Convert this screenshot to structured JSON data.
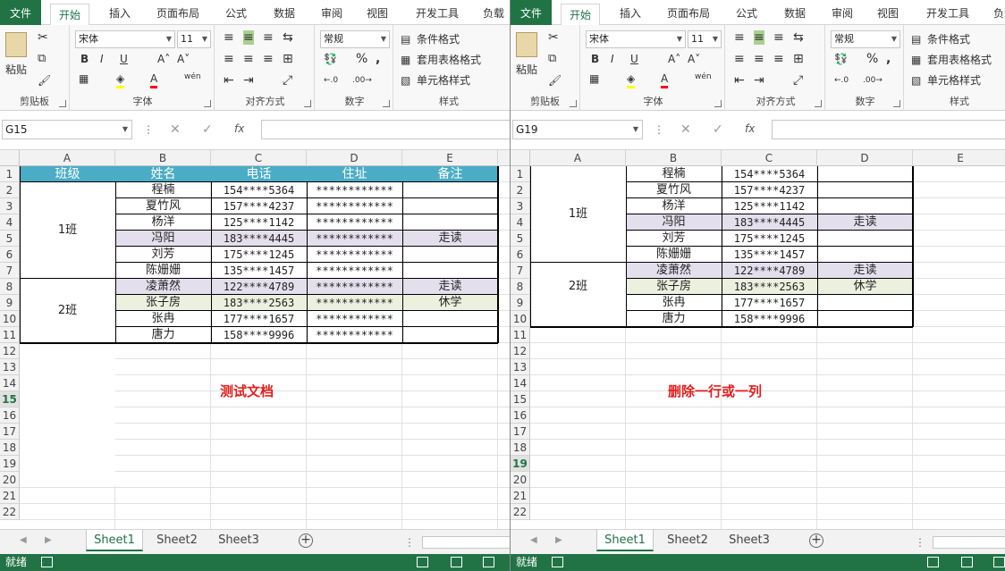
{
  "ribbon_tabs": [
    "文件",
    "开始",
    "插入",
    "页面布局",
    "公式",
    "数据",
    "审阅",
    "视图",
    "开发工具",
    "负载"
  ],
  "ribbon": {
    "clipboard": {
      "paste": "粘贴",
      "label": "剪贴板"
    },
    "font": {
      "name": "宋体",
      "size": "11",
      "label": "字体",
      "bold": "B",
      "italic": "I",
      "underline": "U",
      "wen": "wén"
    },
    "alignment": {
      "label": "对齐方式"
    },
    "number": {
      "format": "常规",
      "percent": "%",
      "comma": ",",
      "label": "数字"
    },
    "styles": {
      "conditional": "条件格式",
      "table": "套用表格格式",
      "cell": "单元格样式",
      "label": "样式"
    }
  },
  "colors": {
    "excel_green": "#217346",
    "header_fill": "#4bacc6",
    "lavender": "#e4dfec",
    "light_green": "#ebf1de",
    "red": "#e02020"
  },
  "columns": [
    "A",
    "B",
    "C",
    "D",
    "E"
  ],
  "left": {
    "namebox": "G15",
    "header_row": [
      "班级",
      "姓名",
      "电话",
      "住址",
      "备注"
    ],
    "class1": "1班",
    "class2": "2班",
    "rows": [
      {
        "name": "程楠",
        "phone": "154****5364",
        "addr": "************",
        "note": ""
      },
      {
        "name": "夏竹风",
        "phone": "157****4237",
        "addr": "************",
        "note": ""
      },
      {
        "name": "杨洋",
        "phone": "125****1142",
        "addr": "************",
        "note": ""
      },
      {
        "name": "冯阳",
        "phone": "183****4445",
        "addr": "************",
        "note": "走读"
      },
      {
        "name": "刘芳",
        "phone": "175****1245",
        "addr": "************",
        "note": ""
      },
      {
        "name": "陈姗姗",
        "phone": "135****1457",
        "addr": "************",
        "note": ""
      },
      {
        "name": "凌萧然",
        "phone": "122****4789",
        "addr": "************",
        "note": "走读"
      },
      {
        "name": "张子房",
        "phone": "183****2563",
        "addr": "************",
        "note": "休学"
      },
      {
        "name": "张冉",
        "phone": "177****1657",
        "addr": "************",
        "note": ""
      },
      {
        "name": "唐力",
        "phone": "158****9996",
        "addr": "************",
        "note": ""
      }
    ],
    "row_numbers": [
      "1",
      "2",
      "3",
      "4",
      "5",
      "6",
      "7",
      "8",
      "9",
      "10",
      "11",
      "12",
      "13",
      "14",
      "15",
      "16",
      "17",
      "18",
      "19",
      "20",
      "21",
      "22"
    ],
    "caption": "测试文档"
  },
  "right": {
    "namebox": "G19",
    "class1": "1班",
    "class2": "2班",
    "rows": [
      {
        "name": "程楠",
        "phone": "154****5364",
        "note": ""
      },
      {
        "name": "夏竹风",
        "phone": "157****4237",
        "note": ""
      },
      {
        "name": "杨洋",
        "phone": "125****1142",
        "note": ""
      },
      {
        "name": "冯阳",
        "phone": "183****4445",
        "note": "走读"
      },
      {
        "name": "刘芳",
        "phone": "175****1245",
        "note": ""
      },
      {
        "name": "陈姗姗",
        "phone": "135****1457",
        "note": ""
      },
      {
        "name": "凌萧然",
        "phone": "122****4789",
        "note": "走读"
      },
      {
        "name": "张子房",
        "phone": "183****2563",
        "note": "休学"
      },
      {
        "name": "张冉",
        "phone": "177****1657",
        "note": ""
      },
      {
        "name": "唐力",
        "phone": "158****9996",
        "note": ""
      }
    ],
    "row_numbers": [
      "1",
      "2",
      "3",
      "4",
      "5",
      "6",
      "7",
      "8",
      "9",
      "10",
      "11",
      "12",
      "13",
      "14",
      "15",
      "16",
      "17",
      "18",
      "19",
      "20",
      "21",
      "22"
    ],
    "caption": "删除一行或一列"
  },
  "sheets": [
    "Sheet1",
    "Sheet2",
    "Sheet3"
  ],
  "status": "就绪"
}
